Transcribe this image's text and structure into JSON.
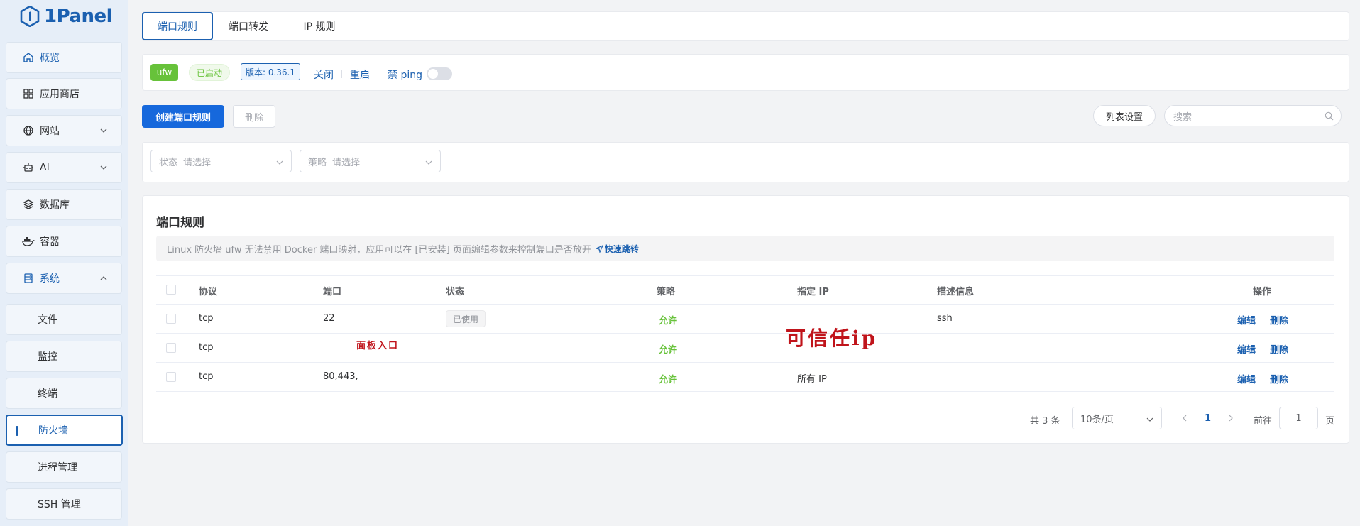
{
  "app": {
    "brand": "1Panel"
  },
  "sidebar": {
    "items": [
      {
        "label": "概览",
        "icon": "home-icon"
      },
      {
        "label": "应用商店",
        "icon": "grid-icon"
      },
      {
        "label": "网站",
        "icon": "globe-icon"
      },
      {
        "label": "AI",
        "icon": "robot-icon"
      },
      {
        "label": "数据库",
        "icon": "layers-icon"
      },
      {
        "label": "容器",
        "icon": "docker-icon"
      },
      {
        "label": "系统",
        "icon": "server-icon"
      }
    ],
    "sub_items": [
      {
        "label": "文件"
      },
      {
        "label": "监控"
      },
      {
        "label": "终端"
      },
      {
        "label": "防火墙"
      },
      {
        "label": "进程管理"
      },
      {
        "label": "SSH 管理"
      }
    ]
  },
  "tabs": [
    {
      "label": "端口规则"
    },
    {
      "label": "端口转发"
    },
    {
      "label": "IP 规则"
    }
  ],
  "status_bar": {
    "ufw": "ufw",
    "running": "已启动",
    "version": "版本: 0.36.1",
    "close": "关闭",
    "restart": "重启",
    "disable_ping": "禁 ping"
  },
  "toolbar": {
    "create": "创建端口规则",
    "delete": "删除",
    "list_settings": "列表设置",
    "search_placeholder": "搜索"
  },
  "filters": {
    "status_prefix": "状态",
    "status_placeholder": "请选择",
    "strategy_prefix": "策略",
    "strategy_placeholder": "请选择"
  },
  "section": {
    "title": "端口规则",
    "alert": "Linux 防火墙 ufw 无法禁用 Docker 端口映射，应用可以在 [已安装] 页面编辑参数来控制端口是否放开",
    "quick_jump": "快速跳转"
  },
  "table": {
    "headers": [
      "协议",
      "端口",
      "状态",
      "策略",
      "指定 IP",
      "描述信息",
      "操作"
    ],
    "rows": [
      {
        "protocol": "tcp",
        "port": "22",
        "status": "已使用",
        "strategy": "允许",
        "ip": "",
        "desc": "ssh"
      },
      {
        "protocol": "tcp",
        "port": "",
        "status": "",
        "strategy": "允许",
        "ip": "",
        "desc": ""
      },
      {
        "protocol": "tcp",
        "port": "80,443,",
        "status": "",
        "strategy": "允许",
        "ip": "所有 IP",
        "desc": ""
      }
    ],
    "edit": "编辑",
    "remove": "删除"
  },
  "annotations": {
    "panel_entry": "面板入口",
    "trusted_ip": "可信任ip"
  },
  "pagination": {
    "total": "共 3 条",
    "page_size": "10条/页",
    "current": "1",
    "goto": "前往",
    "goto_value": "1",
    "page_unit": "页"
  }
}
